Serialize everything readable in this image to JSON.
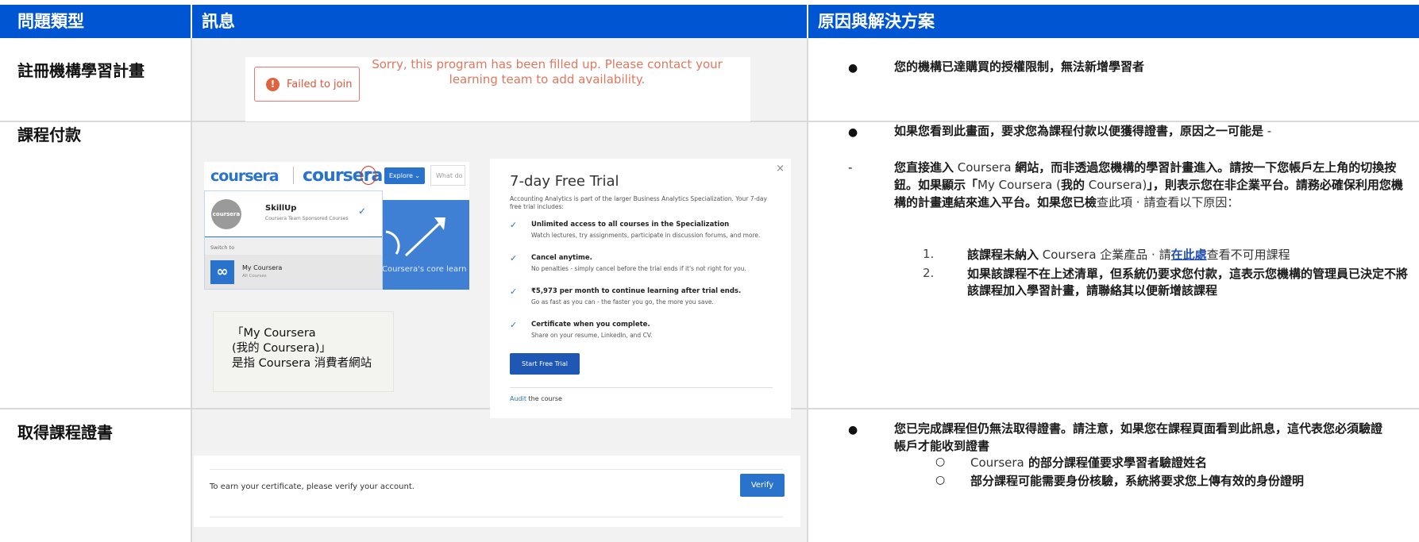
{
  "header": {
    "col_type": "問題類型",
    "col_message": "訊息",
    "col_solution": "原因與解決方案"
  },
  "rows": [
    {
      "label": "註冊機構學習計畫",
      "snippet": {
        "fail_label": "Failed to join",
        "fail_icon": "!",
        "sorry_text": "Sorry, this program has been filled up. Please contact your learning team to add availability."
      },
      "bullets": [
        "您的機構已達購買的授權限制，無法新增學習者"
      ]
    },
    {
      "label": "課程付款",
      "snippet": {
        "logo_left": "coursera",
        "logo_right": "coursera",
        "explore": "Explore ⌄",
        "search_placeholder": "What do",
        "dd_name": "SkillUp",
        "dd_sub": "Coursera Team Sponsored Courses",
        "dd_avatar": "coursera",
        "dd_check": "✓",
        "dd_switch": "Switch to",
        "dd_alt_name": "My Coursera",
        "dd_alt_sub": "All Courses",
        "dd_alt_icon": "∞",
        "art_text": "Coursera's core learn",
        "callout_l1": "「My Coursera",
        "callout_l2": "(我的 Coursera)」",
        "callout_l3": "是指 Coursera 消費者網站",
        "trial": {
          "title": "7-day Free Trial",
          "close": "×",
          "intro": "Accounting Analytics is part of the larger Business Analytics Specialization. Your 7-day free trial includes:",
          "check": "✓",
          "features": [
            {
              "h": "Unlimited access to all courses in the Specialization",
              "s": "Watch lectures, try assignments, participate in discussion forums, and more."
            },
            {
              "h": "Cancel anytime.",
              "s": "No penalties - simply cancel before the trial ends if it's not right for you."
            },
            {
              "h": "₹5,973 per month to continue learning after trial ends.",
              "s": "Go as fast as you can - the faster you go, the more you save."
            },
            {
              "h": "Certificate when you complete.",
              "s": "Share on your resume, LinkedIn, and CV."
            }
          ],
          "start": "Start Free Trial",
          "audit_link": "Audit",
          "audit_rest": " the course"
        }
      },
      "bullet1": "如果您看到此畫面，要求您為課程付款以便獲得證書，原因之一可能是",
      "bullet1_tail": " -",
      "dash": "-",
      "para_a": "您直接進入",
      "para_b": " Coursera ",
      "para_c": "網站，而非透過您機構的學習計畫進入。請按一下您帳戶左上角的切換按鈕。如果顯示「",
      "para_d": "My Coursera (",
      "para_e": "我的",
      "para_f": " Coursera)",
      "para_g": "」，則表示您在非企業平台。請務必確保利用您機構的計畫連結來進入平台。如果您已檢",
      "para_h": "查此項 · 請",
      "para_i": "查看以下原因：",
      "n1": "1.",
      "item1_a": "該課程未納入",
      "item1_b": " Coursera ",
      "item1_c": "企業產品 · 請",
      "item1_link": "在此處",
      "item1_d": "查看不可用課程",
      "n2": "2.",
      "item2": "如果該課程不在上述清單，但系統仍要求您付款，這表示您機構的管理員已決定不將該課程加入學習計畫，請聯絡其以便新增該課程"
    },
    {
      "label": "取得課程證書",
      "snippet": {
        "verify_text": "To earn your certificate, please verify your account.",
        "verify_btn": "Verify"
      },
      "bullet": "您已完成課程但仍無法取得證書。請注意，如果您在課程頁面看到此訊息，這代表您必須驗證帳戶才能收到證書",
      "sub1_a": "Coursera",
      "sub1_b": " 的部分課程僅要求學習者驗證姓名",
      "sub2": "部分課程可能需要身份核驗，系統將要求您上傳有效的身份證明"
    }
  ],
  "symbols": {
    "dot": "●",
    "circle": "○"
  },
  "colors": {
    "header": "#0056d2",
    "accent": "#2a73cc",
    "error": "#e0633f"
  }
}
